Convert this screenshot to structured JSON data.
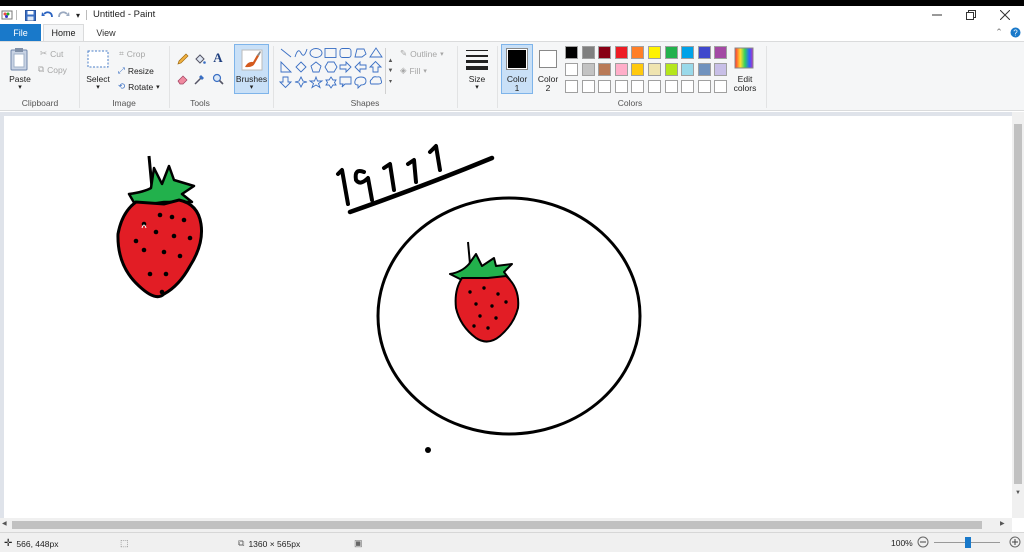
{
  "window": {
    "title": "Untitled - Paint"
  },
  "ribbon_tabs": {
    "file": "File",
    "home": "Home",
    "view": "View"
  },
  "clipboard": {
    "paste": "Paste",
    "cut": "Cut",
    "copy": "Copy",
    "label": "Clipboard"
  },
  "image": {
    "select": "Select",
    "crop": "Crop",
    "resize": "Resize",
    "rotate": "Rotate",
    "label": "Image"
  },
  "tools": {
    "label": "Tools"
  },
  "brushes": {
    "label": "Brushes"
  },
  "shapes": {
    "outline": "Outline",
    "fill": "Fill",
    "label": "Shapes"
  },
  "size": {
    "label": "Size"
  },
  "color1": {
    "label": "Color",
    "num": "1",
    "value": "#000000"
  },
  "color2": {
    "label": "Color",
    "num": "2",
    "value": "#ffffff"
  },
  "colors": {
    "label": "Colors",
    "edit_line1": "Edit",
    "edit_line2": "colors",
    "row1": [
      "#000000",
      "#7f7f7f",
      "#880015",
      "#ed1c24",
      "#ff7f27",
      "#fff200",
      "#22b14c",
      "#00a2e8",
      "#3f48cc",
      "#a349a4"
    ],
    "row2": [
      "#ffffff",
      "#c3c3c3",
      "#b97a57",
      "#ffaec9",
      "#ffc90e",
      "#efe4b0",
      "#b5e61d",
      "#99d9ea",
      "#7092be",
      "#c8bfe7"
    ],
    "row3": [
      "#ffffff",
      "#ffffff",
      "#ffffff",
      "#ffffff",
      "#ffffff",
      "#ffffff",
      "#ffffff",
      "#ffffff",
      "#ffffff",
      "#ffffff"
    ]
  },
  "canvas_art": {
    "year_text": "1911"
  },
  "status": {
    "cursor_pos": "566, 448px",
    "canvas_size": "1360 × 565px",
    "zoom": "100%"
  }
}
